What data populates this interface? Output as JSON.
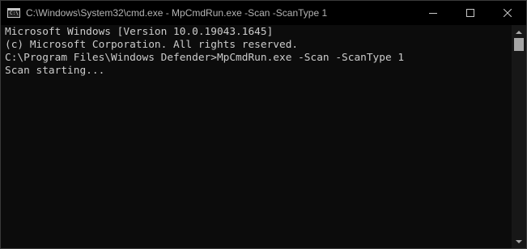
{
  "window": {
    "title": "C:\\Windows\\System32\\cmd.exe - MpCmdRun.exe  -Scan -ScanType 1",
    "icon_label": "C:\\",
    "colors": {
      "background": "#0c0c0c",
      "text": "#cccccc",
      "titlebar": "#000000"
    }
  },
  "controls": {
    "minimize_icon": "minimize-icon",
    "maximize_icon": "maximize-icon",
    "close_icon": "close-icon"
  },
  "console": {
    "lines": [
      "Microsoft Windows [Version 10.0.19043.1645]",
      "(c) Microsoft Corporation. All rights reserved.",
      "",
      "C:\\Program Files\\Windows Defender>MpCmdRun.exe -Scan -ScanType 1",
      "Scan starting..."
    ]
  }
}
